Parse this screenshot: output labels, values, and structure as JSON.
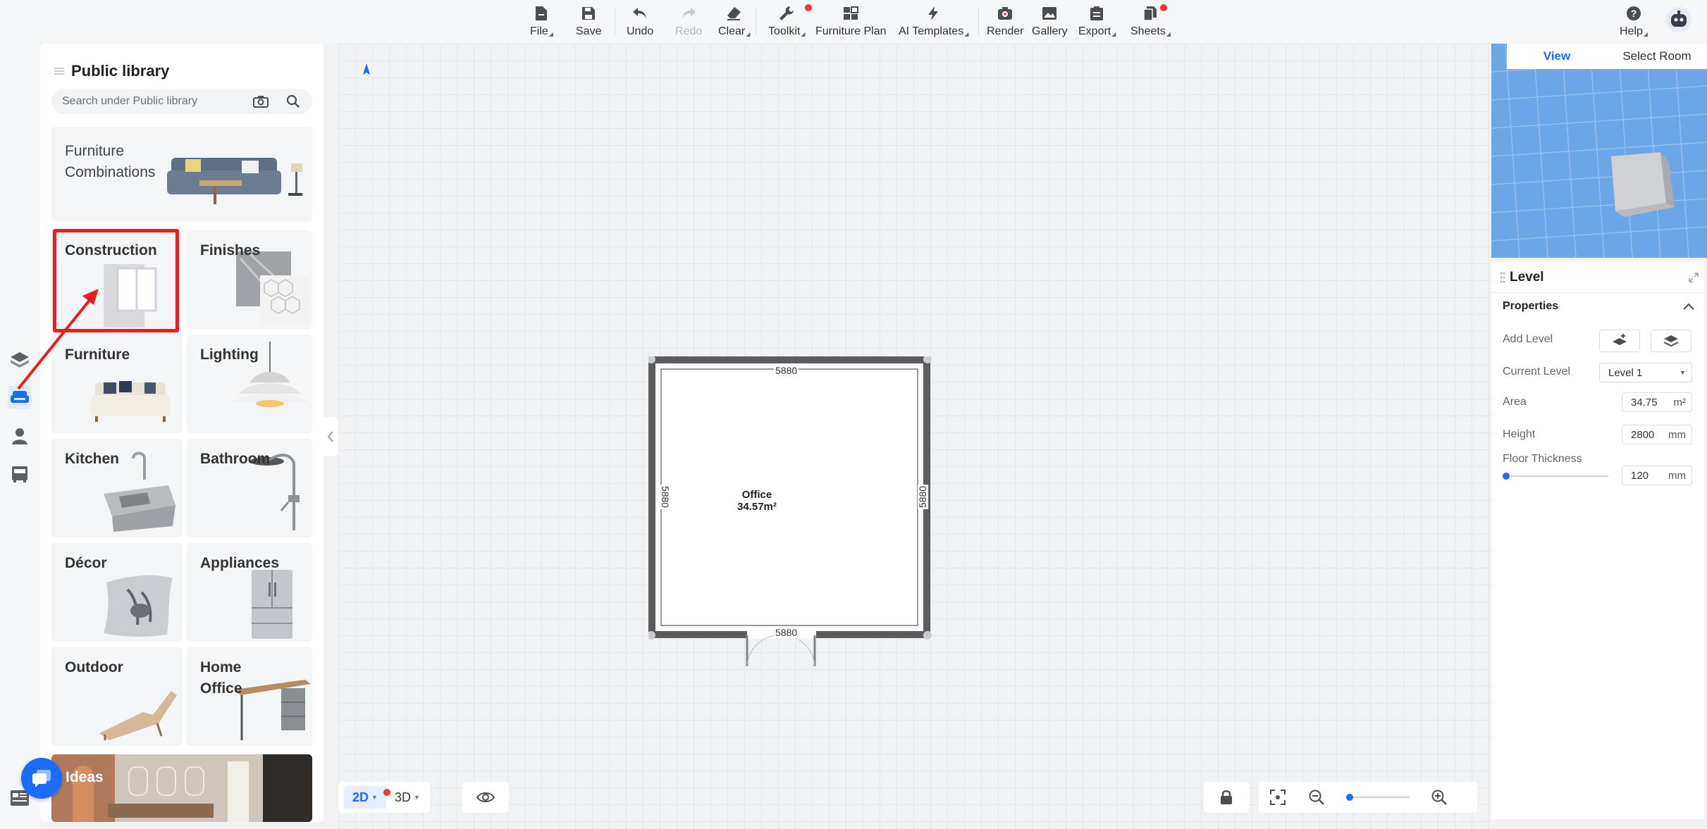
{
  "toolbar": {
    "file": "File",
    "save": "Save",
    "undo": "Undo",
    "redo": "Redo",
    "clear": "Clear",
    "toolkit": "Toolkit",
    "furniture_plan": "Furniture Plan",
    "ai_templates": "AI Templates",
    "render": "Render",
    "gallery": "Gallery",
    "export": "Export",
    "sheets": "Sheets",
    "help": "Help"
  },
  "library": {
    "title": "Public library",
    "search_placeholder": "Search under Public library",
    "cards": {
      "furniture_combinations": "Furniture Combinations",
      "construction": "Construction",
      "finishes": "Finishes",
      "furniture": "Furniture",
      "lighting": "Lighting",
      "kitchen": "Kitchen",
      "bathroom": "Bathroom",
      "decor": "Décor",
      "appliances": "Appliances",
      "outdoor": "Outdoor",
      "home_office": "Home Office",
      "ideas": "Ideas"
    }
  },
  "canvas": {
    "room_name": "Office",
    "room_area": "34.57m²",
    "dim_top": "5880",
    "dim_bottom": "5880",
    "dim_left": "5880",
    "dim_right": "5880"
  },
  "view_controls": {
    "mode_2d": "2D",
    "mode_3d": "3D",
    "active_mode": "2D",
    "zoom_fraction": 0.0
  },
  "minimap": {
    "tab_view": "View",
    "tab_select_room": "Select Room"
  },
  "properties": {
    "panel_title": "Level",
    "section_title": "Properties",
    "add_level_label": "Add Level",
    "current_level_label": "Current Level",
    "current_level_value": "Level 1",
    "area_label": "Area",
    "area_value": "34.75",
    "area_unit": "m²",
    "height_label": "Height",
    "height_value": "2800",
    "height_unit": "mm",
    "floor_thickness_label": "Floor Thickness",
    "floor_thickness_value": "120",
    "floor_thickness_unit": "mm"
  },
  "colors": {
    "accent": "#1a6cff",
    "highlight": "#f01c1c",
    "notification_dot": "#f4372a"
  }
}
